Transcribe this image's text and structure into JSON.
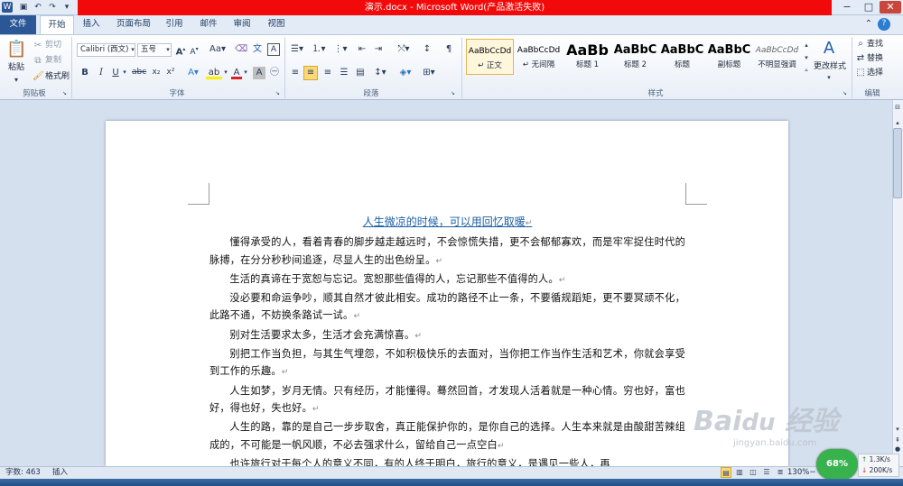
{
  "window": {
    "title": "演示.docx - Microsoft Word(产品激活失败)",
    "controls": [
      "−",
      "□",
      "✕"
    ]
  },
  "tabs": [
    "文件",
    "开始",
    "插入",
    "页面布局",
    "引用",
    "邮件",
    "审阅",
    "视图"
  ],
  "clipboard": {
    "paste": "粘贴",
    "cut": "剪切",
    "copy": "复制",
    "format_painter": "格式刷",
    "label": "剪贴板"
  },
  "font": {
    "name": "Calibri (西文)",
    "size": "五号",
    "label": "字体"
  },
  "paragraph": {
    "label": "段落"
  },
  "styles": {
    "items": [
      {
        "sample": "AaBbCcDd",
        "name": "↵ 正文"
      },
      {
        "sample": "AaBbCcDd",
        "name": "↵ 无间隔"
      },
      {
        "sample": "AaBb",
        "name": "标题 1"
      },
      {
        "sample": "AaBbC",
        "name": "标题 2"
      },
      {
        "sample": "AaBbC",
        "name": "标题"
      },
      {
        "sample": "AaBbC",
        "name": "副标题"
      },
      {
        "sample": "AaBbCcDd",
        "name": "不明显强调"
      }
    ],
    "change": "更改样式",
    "label": "样式"
  },
  "editing": {
    "find": "查找",
    "replace": "替换",
    "select": "选择",
    "label": "编辑"
  },
  "document": {
    "title": "人生微凉的时候，可以用回忆取暖",
    "paragraphs": [
      "懂得承受的人，看着青春的脚步越走越远时，不会惊慌失措，更不会郁郁寡欢，而是牢牢捉住时代的脉搏，在分分秒秒间追逐，尽显人生的出色纷呈。",
      "生活的真谛在于宽恕与忘记。宽恕那些值得的人，忘记那些不值得的人。",
      "没必要和命运争吵，顺其自然才彼此相安。成功的路径不止一条，不要循规蹈矩，更不要冥顽不化，此路不通，不妨换条路试一试。",
      "别对生活要求太多，生活才会充满惊喜。",
      "别把工作当负担，与其生气埋怨，不如积极快乐的去面对，当你把工作当作生活和艺术，你就会享受到工作的乐趣。",
      "人生如梦，岁月无情。只有经历，才能懂得。蓦然回首，才发现人活着就是一种心情。穷也好，富也好，得也好，失也好。",
      "人生的路，靠的是自己一步步取舍，真正能保护你的，是你自己的选择。人生本来就是由酸甜苦辣组成的，不可能是一帆风顺，不必去强求什么，留给自己一点空白",
      "也许旅行对于每个人的意义不同，有的人终于明白，旅行的意义，是遇见一些人，再"
    ]
  },
  "status": {
    "word_count": "字数: 463",
    "mode": "插入",
    "zoom": "130%"
  },
  "overlay": {
    "meter": "68%",
    "up": "1.3K/s",
    "down": "200K/s",
    "watermark_url": "jingyan.baidu.com"
  }
}
